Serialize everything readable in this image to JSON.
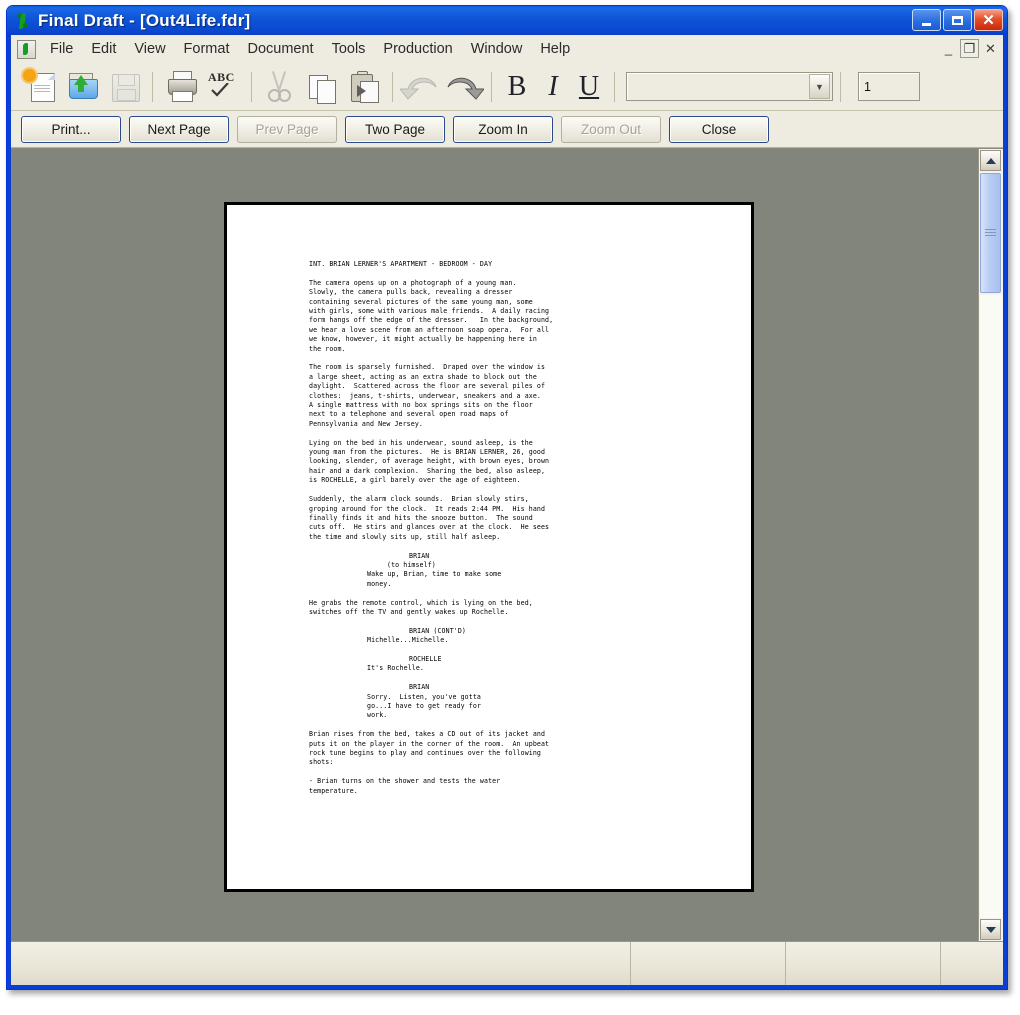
{
  "window": {
    "title": "Final Draft  - [Out4Life.fdr]",
    "app_icon": "final-draft-icon",
    "minimize_label": "_",
    "maximize_label": "□",
    "close_label": "✕"
  },
  "menubar": {
    "items": [
      {
        "label": "File"
      },
      {
        "label": "Edit"
      },
      {
        "label": "View"
      },
      {
        "label": "Format"
      },
      {
        "label": "Document"
      },
      {
        "label": "Tools"
      },
      {
        "label": "Production"
      },
      {
        "label": "Window"
      },
      {
        "label": "Help"
      }
    ],
    "mdi_minimize": "_",
    "mdi_restore": "❐",
    "mdi_close": "✕"
  },
  "toolbar": {
    "buttons": [
      {
        "name": "new-document-icon",
        "enabled": true
      },
      {
        "name": "open-document-icon",
        "enabled": true
      },
      {
        "name": "save-document-icon",
        "enabled": false
      },
      {
        "name": "print-icon",
        "enabled": true
      },
      {
        "name": "spell-check-icon",
        "enabled": true,
        "label": "ABC"
      },
      {
        "name": "cut-icon",
        "enabled": false
      },
      {
        "name": "copy-icon",
        "enabled": true
      },
      {
        "name": "paste-icon",
        "enabled": true
      },
      {
        "name": "undo-icon",
        "enabled": false
      },
      {
        "name": "redo-icon",
        "enabled": true
      }
    ],
    "bold_label": "B",
    "italic_label": "I",
    "underline_label": "U",
    "font_value": "",
    "font_size_value": "1",
    "dropdown_glyph": "▼"
  },
  "preview_bar": {
    "print_label": "Print...",
    "next_page_label": "Next Page",
    "prev_page_label": "Prev Page",
    "two_page_label": "Two Page",
    "zoom_in_label": "Zoom In",
    "zoom_out_label": "Zoom Out",
    "close_label": "Close"
  },
  "scrollbar": {
    "up_glyph": "▲",
    "down_glyph": "▼"
  },
  "statusbar": {
    "pane1": "",
    "pane2": "",
    "pane3": "",
    "pane4": ""
  },
  "document": {
    "blocks": [
      {
        "type": "scene-heading",
        "lines": [
          "INT. BRIAN LERNER'S APARTMENT - BEDROOM - DAY"
        ]
      },
      {
        "type": "action",
        "lines": [
          "The camera opens up on a photograph of a young man.",
          "Slowly, the camera pulls back, revealing a dresser",
          "containing several pictures of the same young man, some",
          "with girls, some with various male friends.  A daily racing",
          "form hangs off the edge of the dresser.   In the background,",
          "we hear a love scene from an afternoon soap opera.  For all",
          "we know, however, it might actually be happening here in",
          "the room."
        ]
      },
      {
        "type": "action",
        "lines": [
          "The room is sparsely furnished.  Draped over the window is",
          "a large sheet, acting as an extra shade to block out the",
          "daylight.  Scattered across the floor are several piles of",
          "clothes:  jeans, t-shirts, underwear, sneakers and a axe.",
          "A single mattress with no box springs sits on the floor",
          "next to a telephone and several open road maps of",
          "Pennsylvania and New Jersey."
        ]
      },
      {
        "type": "action",
        "lines": [
          "Lying on the bed in his underwear, sound asleep, is the",
          "young man from the pictures.  He is BRIAN LERNER, 26, good",
          "looking, slender, of average height, with brown eyes, brown",
          "hair and a dark complexion.  Sharing the bed, also asleep,",
          "is ROCHELLE, a girl barely over the age of eighteen."
        ]
      },
      {
        "type": "action",
        "lines": [
          "Suddenly, the alarm clock sounds.  Brian slowly stirs,",
          "groping around for the clock.  It reads 2:44 PM.  His hand",
          "finally finds it and hits the snooze button.  The sound",
          "cuts off.  He stirs and glances over at the clock.  He sees",
          "the time and slowly sits up, still half asleep."
        ]
      },
      {
        "type": "character",
        "lines": [
          "BRIAN"
        ]
      },
      {
        "type": "parenthetical",
        "lines": [
          "(to himself)"
        ]
      },
      {
        "type": "dialogue",
        "lines": [
          "Wake up, Brian, time to make some",
          "money."
        ]
      },
      {
        "type": "action",
        "lines": [
          "He grabs the remote control, which is lying on the bed,",
          "switches off the TV and gently wakes up Rochelle."
        ]
      },
      {
        "type": "character",
        "lines": [
          "BRIAN (CONT'D)"
        ]
      },
      {
        "type": "dialogue",
        "lines": [
          "Michelle...Michelle."
        ]
      },
      {
        "type": "character",
        "lines": [
          "ROCHELLE"
        ]
      },
      {
        "type": "dialogue",
        "lines": [
          "It's Rochelle."
        ]
      },
      {
        "type": "character",
        "lines": [
          "BRIAN"
        ]
      },
      {
        "type": "dialogue",
        "lines": [
          "Sorry.  Listen, you've gotta",
          "go...I have to get ready for",
          "work."
        ]
      },
      {
        "type": "action",
        "lines": [
          "Brian rises from the bed, takes a CD out of its jacket and",
          "puts it on the player in the corner of the room.  An upbeat",
          "rock tune begins to play and continues over the following",
          "shots:"
        ]
      },
      {
        "type": "action",
        "lines": [
          "- Brian turns on the shower and tests the water",
          "temperature."
        ]
      }
    ]
  }
}
